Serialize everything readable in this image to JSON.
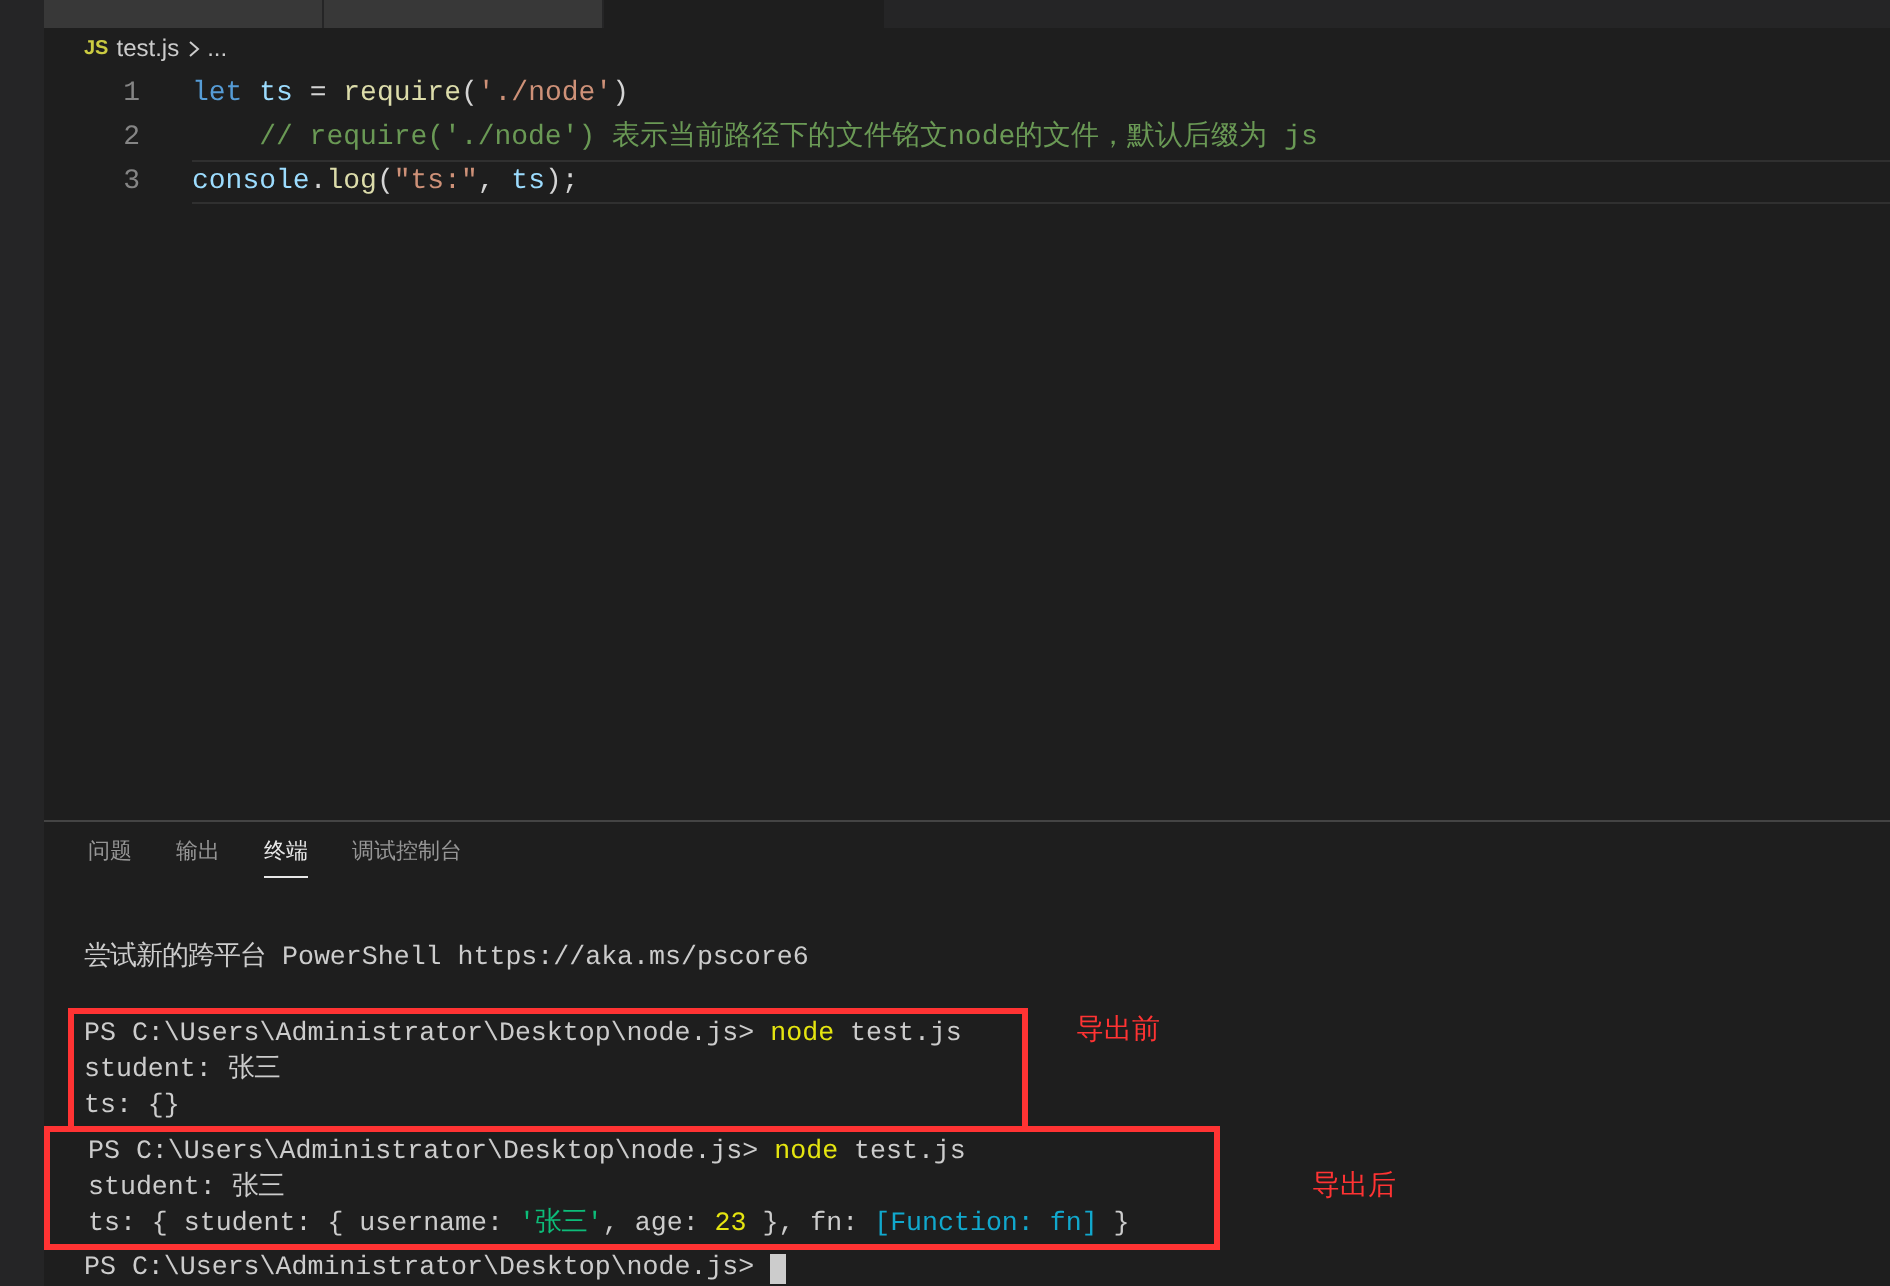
{
  "editor_tabs": [
    {
      "selected": false
    },
    {
      "selected": false
    },
    {
      "selected": true
    }
  ],
  "breadcrumb": {
    "file_badge": "JS",
    "file": "test.js",
    "more": "..."
  },
  "code_lines": [
    {
      "number": "1",
      "current": false,
      "tokens": [
        {
          "text": "let",
          "kind": "keyword"
        },
        {
          "text": " ts",
          "kind": "variable"
        },
        {
          "text": " = ",
          "kind": "plain"
        },
        {
          "text": "require",
          "kind": "function"
        },
        {
          "text": "(",
          "kind": "plain"
        },
        {
          "text": "'./node'",
          "kind": "string"
        },
        {
          "text": ")",
          "kind": "plain"
        }
      ]
    },
    {
      "number": "2",
      "current": false,
      "tokens": [
        {
          "text": "    // require('./node') 表示当前路径下的文件铭文node的文件，默认后缀为 js",
          "kind": "comment"
        }
      ]
    },
    {
      "number": "3",
      "current": true,
      "tokens": [
        {
          "text": "console",
          "kind": "variable"
        },
        {
          "text": ".",
          "kind": "plain"
        },
        {
          "text": "log",
          "kind": "function"
        },
        {
          "text": "(",
          "kind": "plain"
        },
        {
          "text": "\"ts:\"",
          "kind": "string"
        },
        {
          "text": ", ",
          "kind": "plain"
        },
        {
          "text": "ts",
          "kind": "variable"
        },
        {
          "text": ");",
          "kind": "plain"
        }
      ]
    }
  ],
  "panel_tabs": [
    {
      "label": "问题",
      "selected": false
    },
    {
      "label": "输出",
      "selected": false
    },
    {
      "label": "终端",
      "selected": true
    },
    {
      "label": "调试控制台",
      "selected": false
    }
  ],
  "terminal": {
    "intro": "尝试新的跨平台 PowerShell https://aka.ms/pscore6",
    "annotated_runs": [
      {
        "annotation": "导出前",
        "lines": [
          [
            {
              "text": "PS C:\\Users\\Administrator\\Desktop\\node.js> ",
              "kind": "plain"
            },
            {
              "text": "node",
              "kind": "command"
            },
            {
              "text": " test.js",
              "kind": "plain"
            }
          ],
          [
            {
              "text": "student: 张三",
              "kind": "plain"
            }
          ],
          [
            {
              "text": "ts: {}",
              "kind": "plain"
            }
          ]
        ]
      },
      {
        "annotation": "导出后",
        "lines": [
          [
            {
              "text": "PS C:\\Users\\Administrator\\Desktop\\node.js> ",
              "kind": "plain"
            },
            {
              "text": "node",
              "kind": "command"
            },
            {
              "text": " test.js",
              "kind": "plain"
            }
          ],
          [
            {
              "text": "student: 张三",
              "kind": "plain"
            }
          ],
          [
            {
              "text": "ts: { student: { username: ",
              "kind": "plain"
            },
            {
              "text": "'张三'",
              "kind": "string"
            },
            {
              "text": ", age: ",
              "kind": "plain"
            },
            {
              "text": "23",
              "kind": "number"
            },
            {
              "text": " }, fn: ",
              "kind": "plain"
            },
            {
              "text": "[Function: fn]",
              "kind": "function"
            },
            {
              "text": " }",
              "kind": "plain"
            }
          ]
        ]
      }
    ],
    "prompt": "PS C:\\Users\\Administrator\\Desktop\\node.js>",
    "cursor": true
  }
}
